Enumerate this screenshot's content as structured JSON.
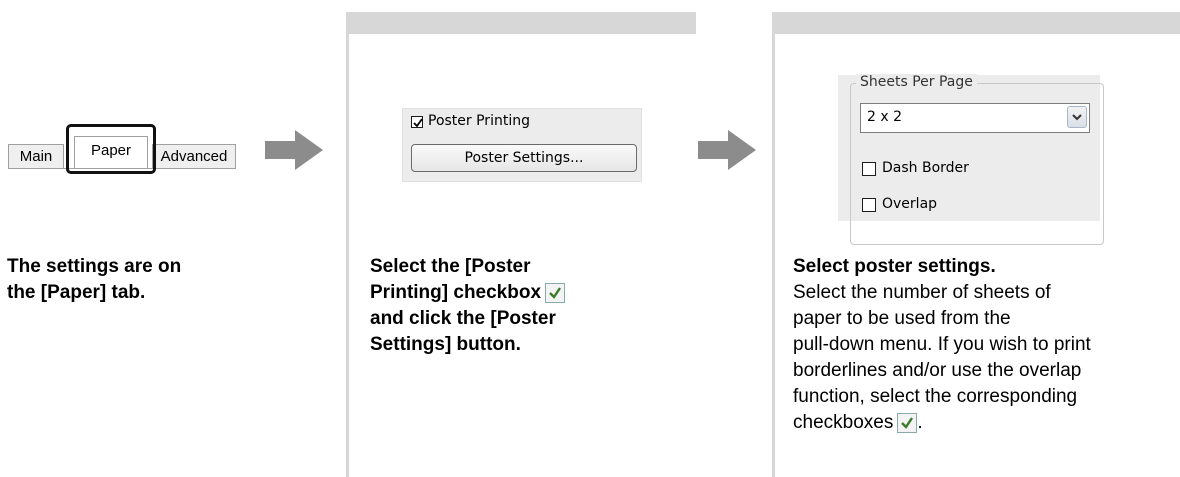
{
  "step1": {
    "tabs": [
      "Main",
      "Paper",
      "Advanced"
    ],
    "caption": [
      "The settings are on",
      "the [Paper] tab."
    ]
  },
  "step2": {
    "checkbox_label": "Poster Printing",
    "button_label": "Poster Settings...",
    "caption": [
      "Select the [Poster",
      "Printing] checkbox",
      "and click the [Poster",
      "Settings] button."
    ]
  },
  "step3": {
    "group_title": "Sheets Per Page",
    "select_value": "2 x 2",
    "checkbox1_label": "Dash Border",
    "checkbox2_label": "Overlap",
    "caption_title": "Select poster settings.",
    "caption_lines": [
      "Select the number of sheets of",
      "paper to be used from the",
      "pull-down menu. If you wish to print",
      "borderlines and/or use the overlap",
      "function, select the corresponding",
      "checkboxes"
    ],
    "caption_end": "."
  },
  "colors": {
    "panel": "#d7d7d7",
    "arrow": "#8c8c8c",
    "highlight": "#111111",
    "check": "#3a7a2a"
  },
  "icons": [
    "right-arrow-icon",
    "checkmark-icon",
    "chevron-down-icon"
  ]
}
